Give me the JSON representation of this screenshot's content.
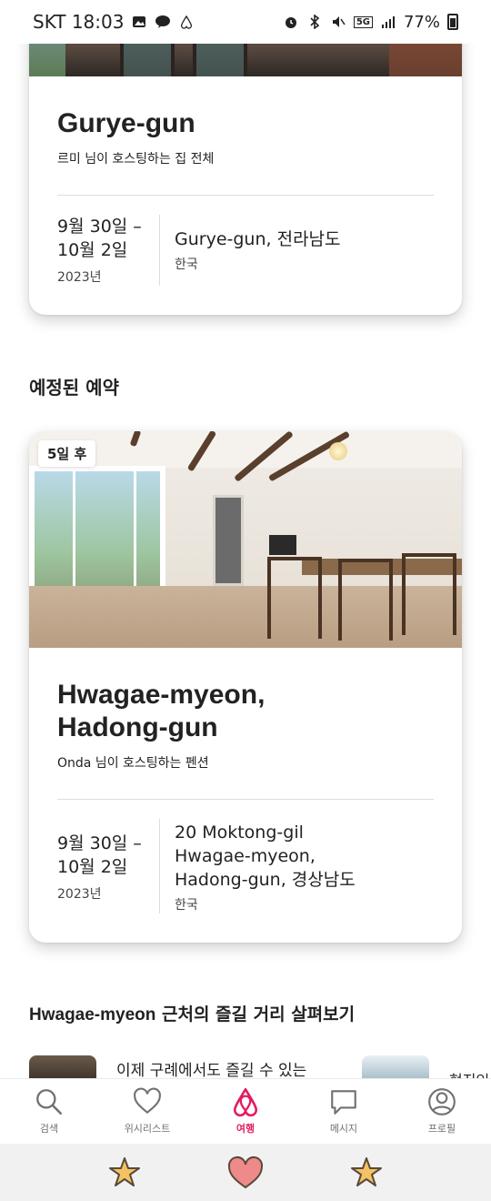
{
  "status_bar": {
    "carrier_time": "SKT 18:03",
    "battery": "77%",
    "network": "5G"
  },
  "past_trip": {
    "title": "Gurye-gun",
    "host_line": "르미 님이 호스팅하는 집 전체",
    "dates_line1": "9월 30일 –",
    "dates_line2": "10월 2일",
    "year": "2023년",
    "address_line1": "Gurye-gun, 전라남도",
    "country": "한국"
  },
  "section": {
    "upcoming_title": "예정된 예약"
  },
  "upcoming_trip": {
    "badge": "5일 후",
    "title_line1": "Hwagae-myeon,",
    "title_line2": "Hadong-gun",
    "host_line": "Onda 님이 호스팅하는 펜션",
    "dates_line1": "9월 30일 –",
    "dates_line2": "10월 2일",
    "year": "2023년",
    "address_line1": "20 Moktong-gil",
    "address_line2": "Hwagae-myeon,",
    "address_line3": "Hadong-gun, 경상남도",
    "country": "한국"
  },
  "explore": {
    "title_bold": "Hwagae-myeon",
    "title_rest": " 근처의 즐길 거리 살펴보기",
    "item1_text": "이제 구례에서도 즐길 수 있는",
    "item2_text": "현지인"
  },
  "tabs": [
    {
      "label": "검색",
      "icon": "search-icon"
    },
    {
      "label": "위시리스트",
      "icon": "heart-icon"
    },
    {
      "label": "여행",
      "icon": "airbnb-logo-icon"
    },
    {
      "label": "메시지",
      "icon": "message-icon"
    },
    {
      "label": "프로필",
      "icon": "profile-icon"
    }
  ],
  "colors": {
    "accent": "#E31C5F",
    "text": "#222222",
    "muted": "#717171"
  }
}
